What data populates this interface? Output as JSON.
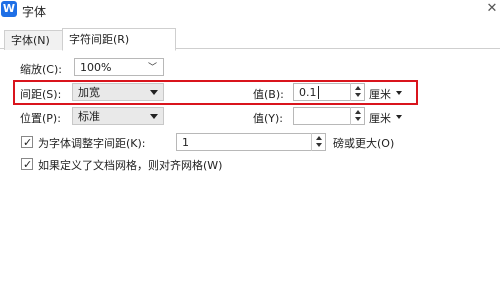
{
  "window": {
    "title": "字体",
    "app_icon_letter": "W"
  },
  "tabs": [
    {
      "label": "字体(N)",
      "active": false
    },
    {
      "label": "字符间距(R)",
      "active": true
    }
  ],
  "scale": {
    "label": "缩放(C):",
    "value": "100%"
  },
  "spacing": {
    "label": "间距(S):",
    "value": "加宽",
    "amount_label": "值(B):",
    "amount_value": "0.1",
    "unit": "厘米"
  },
  "position": {
    "label": "位置(P):",
    "value": "标准",
    "amount_label": "值(Y):",
    "amount_value": "",
    "unit": "厘米"
  },
  "kerning": {
    "checked": true,
    "label": "为字体调整字间距(K):",
    "value": "1",
    "suffix": "磅或更大(O)"
  },
  "grid": {
    "checked": true,
    "label": "如果定义了文档网格，则对齐网格(W)"
  },
  "colors": {
    "highlight": "#d9141c",
    "app_icon": "#1e6fe6"
  }
}
